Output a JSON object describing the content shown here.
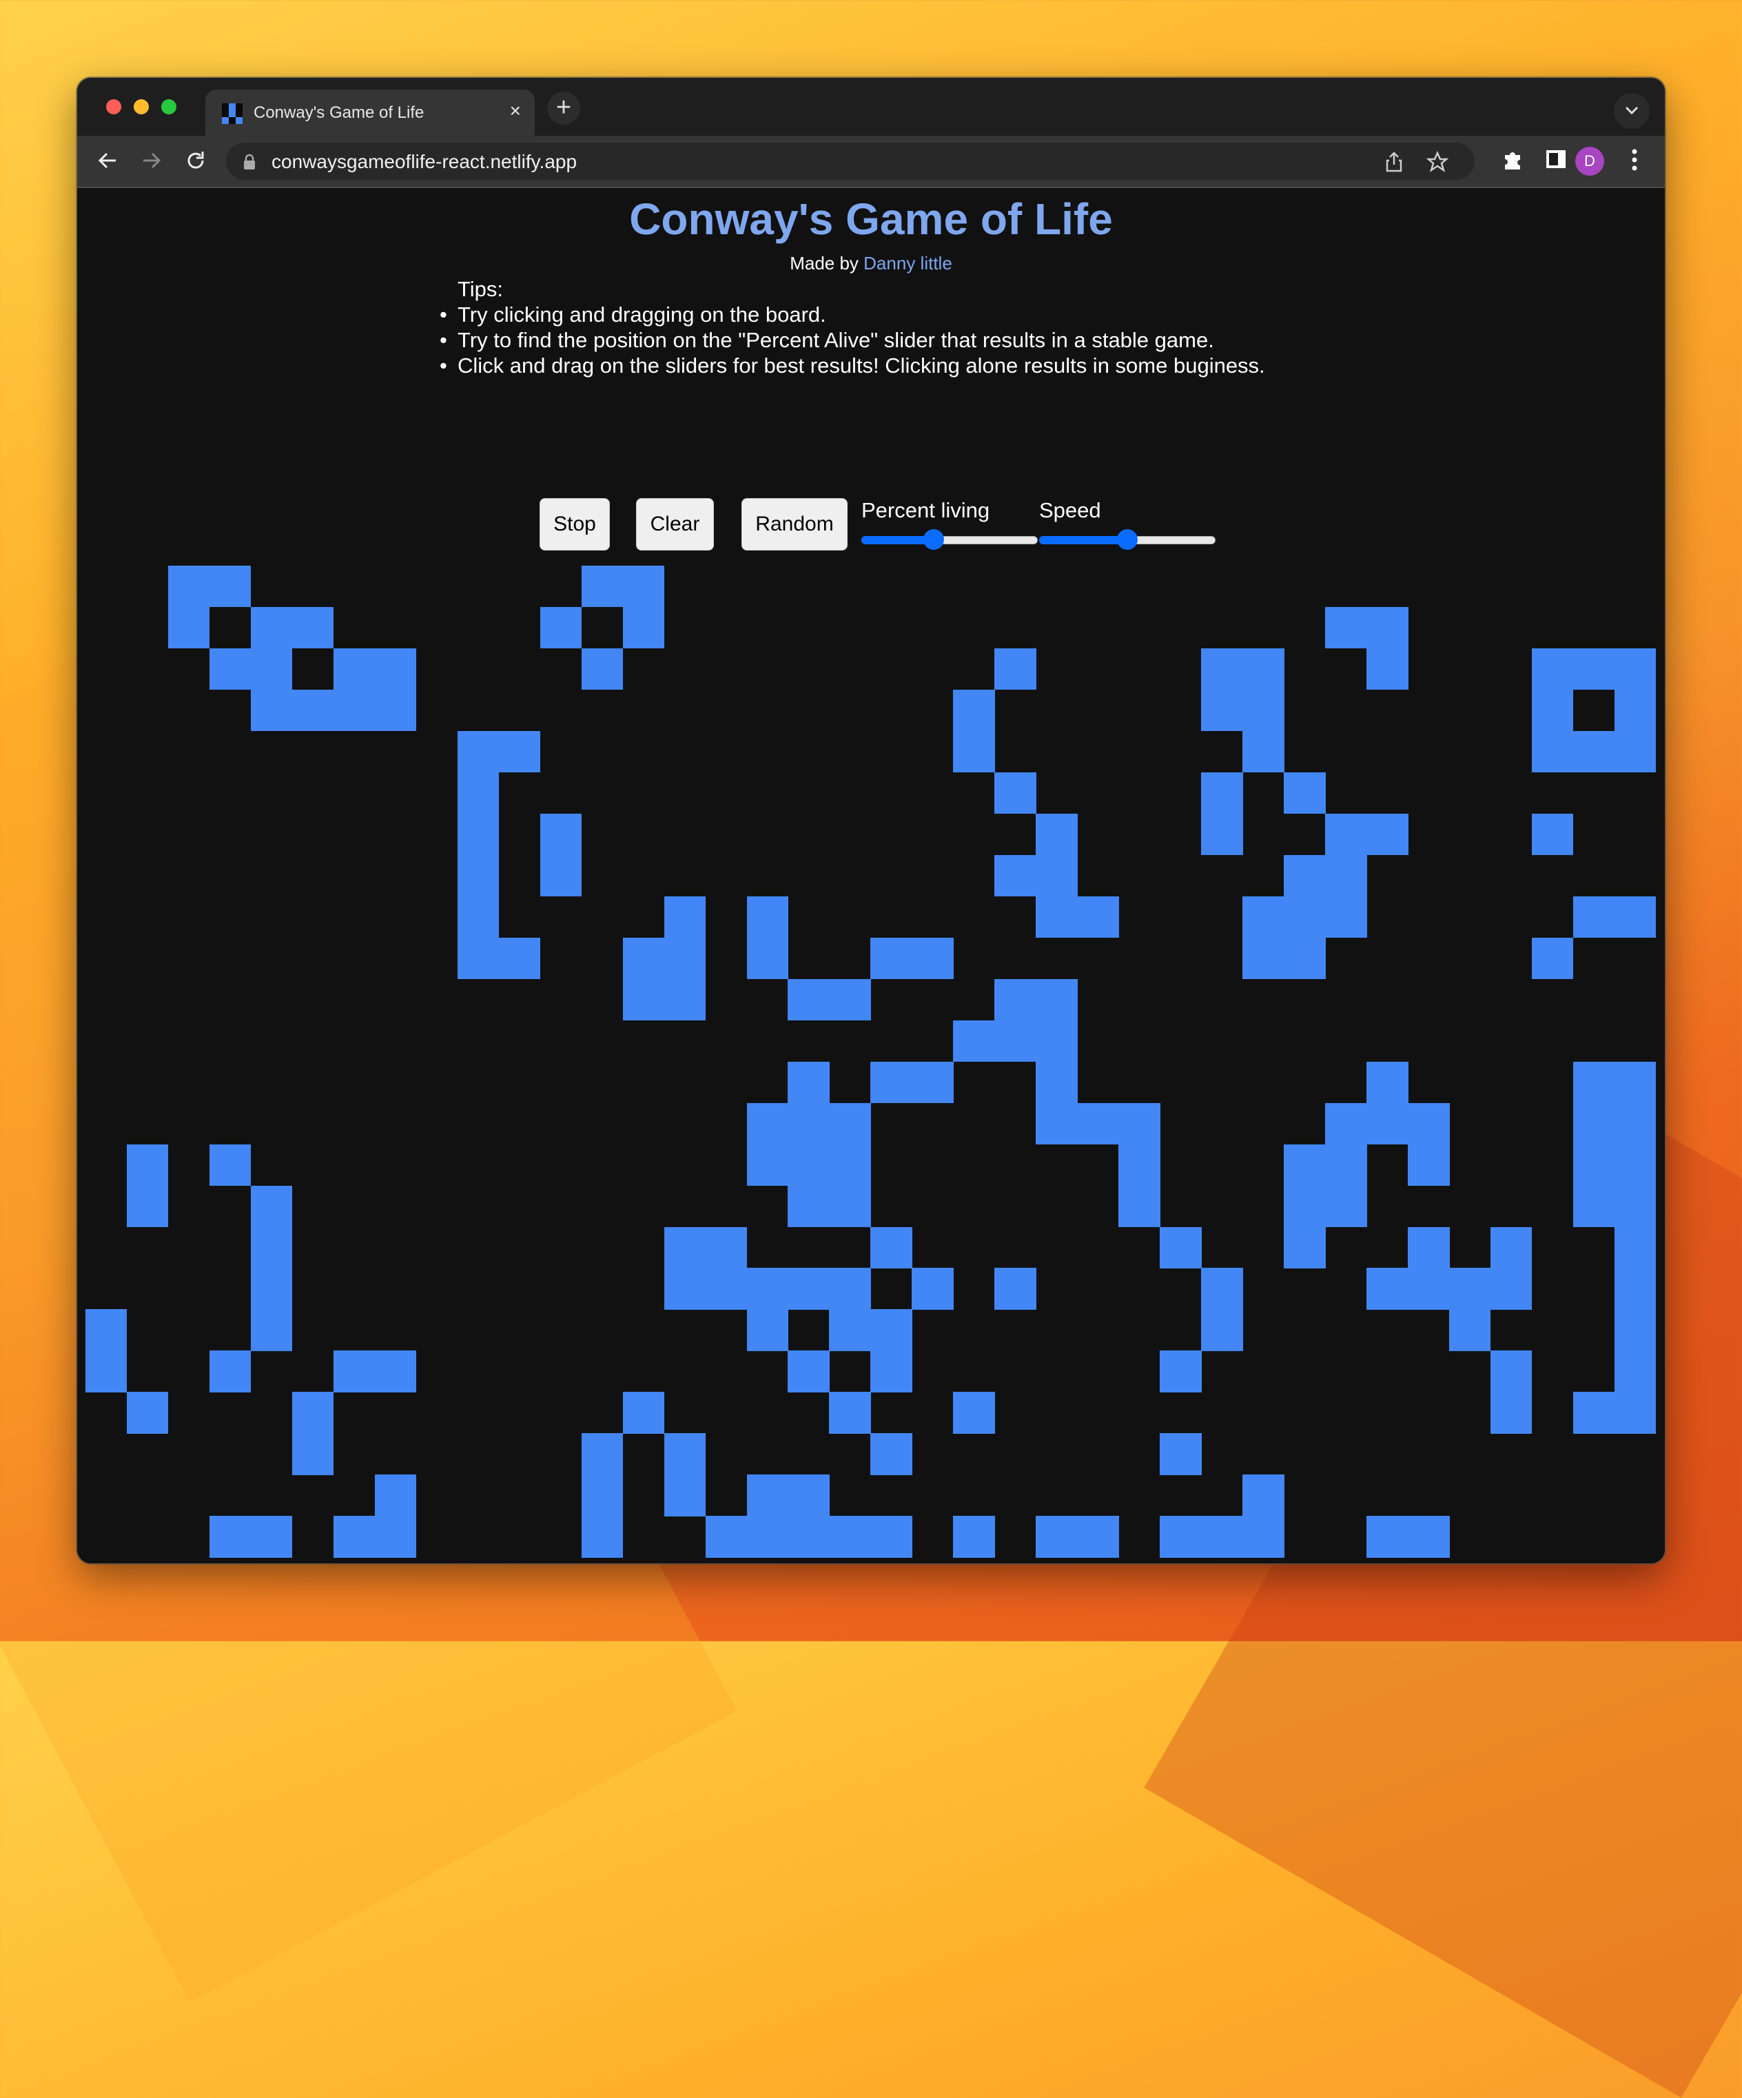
{
  "browser": {
    "tab_title": "Conway's Game of Life",
    "tab_close": "×",
    "new_tab": "+",
    "url": "conwaysgameoflife-react.netlify.app",
    "profile_initial": "D",
    "colors": {
      "profile": "#a845c1"
    }
  },
  "page": {
    "title": "Conway's Game of Life",
    "byline_prefix": "Made by ",
    "author_link": "Danny little",
    "tips_heading": "Tips:",
    "tips": [
      "Try clicking and dragging on the board.",
      "Try to find the position on the \"Percent Alive\" slider that results in a stable game.",
      "Click and drag on the sliders for best results! Clicking alone results in some buginess."
    ],
    "buttons": {
      "stop": "Stop",
      "clear": "Clear",
      "random": "Random"
    },
    "sliders": {
      "percent_living": {
        "label": "Percent living",
        "value_fraction": 0.41
      },
      "speed": {
        "label": "Speed",
        "value_fraction": 0.5
      }
    },
    "colors": {
      "title": "#7ea7ee",
      "live_cell": "#4287f5",
      "board_bg": "#111111",
      "slider_accent": "#0a6cff"
    }
  },
  "board": {
    "columns": 38,
    "rows": 26,
    "live_cells_by_row": [
      [
        2,
        3,
        12,
        13
      ],
      [
        2,
        4,
        5,
        11,
        13,
        30,
        31
      ],
      [
        3,
        4,
        6,
        7,
        12,
        22,
        27,
        28,
        31,
        35,
        36,
        37
      ],
      [
        4,
        5,
        6,
        7,
        21,
        27,
        28,
        35,
        37
      ],
      [
        9,
        10,
        21,
        28,
        35,
        36,
        37
      ],
      [
        9,
        22,
        27,
        29
      ],
      [
        9,
        11,
        23,
        27,
        30,
        31,
        35
      ],
      [
        9,
        11,
        22,
        23,
        29,
        30
      ],
      [
        9,
        14,
        16,
        23,
        24,
        28,
        29,
        30,
        36,
        37
      ],
      [
        9,
        10,
        13,
        14,
        16,
        19,
        20,
        28,
        29,
        35
      ],
      [
        13,
        14,
        17,
        18,
        22,
        23
      ],
      [
        21,
        22,
        23
      ],
      [
        17,
        19,
        20,
        23,
        31,
        36,
        37
      ],
      [
        16,
        17,
        18,
        23,
        24,
        25,
        30,
        31,
        32,
        36,
        37
      ],
      [
        1,
        3,
        16,
        17,
        18,
        25,
        29,
        30,
        32,
        36,
        37
      ],
      [
        1,
        4,
        17,
        18,
        25,
        29,
        30,
        36,
        37
      ],
      [
        4,
        14,
        15,
        19,
        26,
        29,
        32,
        34,
        37
      ],
      [
        4,
        14,
        15,
        16,
        17,
        18,
        20,
        22,
        27,
        31,
        32,
        33,
        34,
        37
      ],
      [
        0,
        4,
        16,
        18,
        19,
        27,
        33,
        37
      ],
      [
        0,
        3,
        6,
        7,
        17,
        19,
        26,
        34,
        37
      ],
      [
        1,
        5,
        13,
        18,
        21,
        34,
        36,
        37
      ],
      [
        5,
        12,
        14,
        19,
        26
      ],
      [
        7,
        12,
        14,
        16,
        17,
        28
      ],
      [
        3,
        4,
        6,
        7,
        12,
        15,
        16,
        17,
        18,
        19,
        21,
        23,
        24,
        26,
        27,
        28,
        31,
        32
      ],
      [],
      []
    ]
  }
}
